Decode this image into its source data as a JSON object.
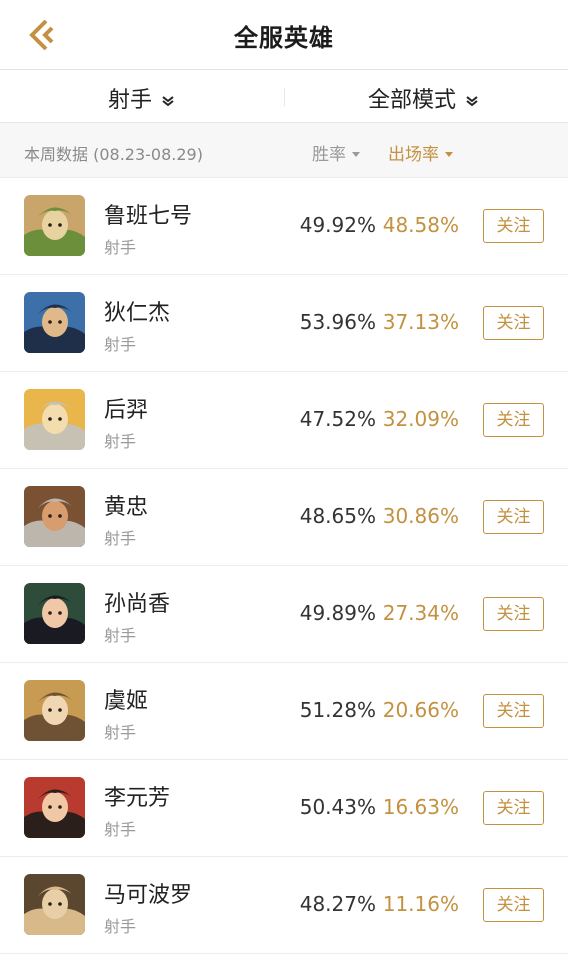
{
  "header": {
    "title": "全服英雄"
  },
  "filters": {
    "role": "射手",
    "mode": "全部模式"
  },
  "subbar": {
    "period": "本周数据 (08.23-08.29)",
    "sort_winrate": "胜率",
    "sort_pickrate": "出场率"
  },
  "colors": {
    "accent": "#c3913f",
    "text": "#333333",
    "muted": "#9a9a9a"
  },
  "heroes": [
    {
      "name": "鲁班七号",
      "role": "射手",
      "winrate": "49.92%",
      "pickrate": "48.58%",
      "follow": "关注",
      "avatar_icon": "luban-avatar",
      "palette": [
        "#c9a46b",
        "#6b8f3a",
        "#e8d3a0"
      ]
    },
    {
      "name": "狄仁杰",
      "role": "射手",
      "winrate": "53.96%",
      "pickrate": "37.13%",
      "follow": "关注",
      "avatar_icon": "direnjie-avatar",
      "palette": [
        "#3d6fa8",
        "#1f2f4a",
        "#e0b98a"
      ]
    },
    {
      "name": "后羿",
      "role": "射手",
      "winrate": "47.52%",
      "pickrate": "32.09%",
      "follow": "关注",
      "avatar_icon": "houyi-avatar",
      "palette": [
        "#e8b64a",
        "#c7c1b4",
        "#f3dcae"
      ]
    },
    {
      "name": "黄忠",
      "role": "射手",
      "winrate": "48.65%",
      "pickrate": "30.86%",
      "follow": "关注",
      "avatar_icon": "huangzhong-avatar",
      "palette": [
        "#7a5233",
        "#bdb6ad",
        "#d79d6f"
      ]
    },
    {
      "name": "孙尚香",
      "role": "射手",
      "winrate": "49.89%",
      "pickrate": "27.34%",
      "follow": "关注",
      "avatar_icon": "sunshangxiang-avatar",
      "palette": [
        "#2d4c3a",
        "#1a1a22",
        "#f0c8a8"
      ]
    },
    {
      "name": "虞姬",
      "role": "射手",
      "winrate": "51.28%",
      "pickrate": "20.66%",
      "follow": "关注",
      "avatar_icon": "yuji-avatar",
      "palette": [
        "#c89b52",
        "#6e5233",
        "#f1d6b3"
      ]
    },
    {
      "name": "李元芳",
      "role": "射手",
      "winrate": "50.43%",
      "pickrate": "16.63%",
      "follow": "关注",
      "avatar_icon": "liyuanfang-avatar",
      "palette": [
        "#b93a2e",
        "#2b1f1c",
        "#f0c8a6"
      ]
    },
    {
      "name": "马可波罗",
      "role": "射手",
      "winrate": "48.27%",
      "pickrate": "11.16%",
      "follow": "关注",
      "avatar_icon": "makeboluo-avatar",
      "palette": [
        "#5b4630",
        "#d7b98a",
        "#e9cfa8"
      ]
    }
  ]
}
